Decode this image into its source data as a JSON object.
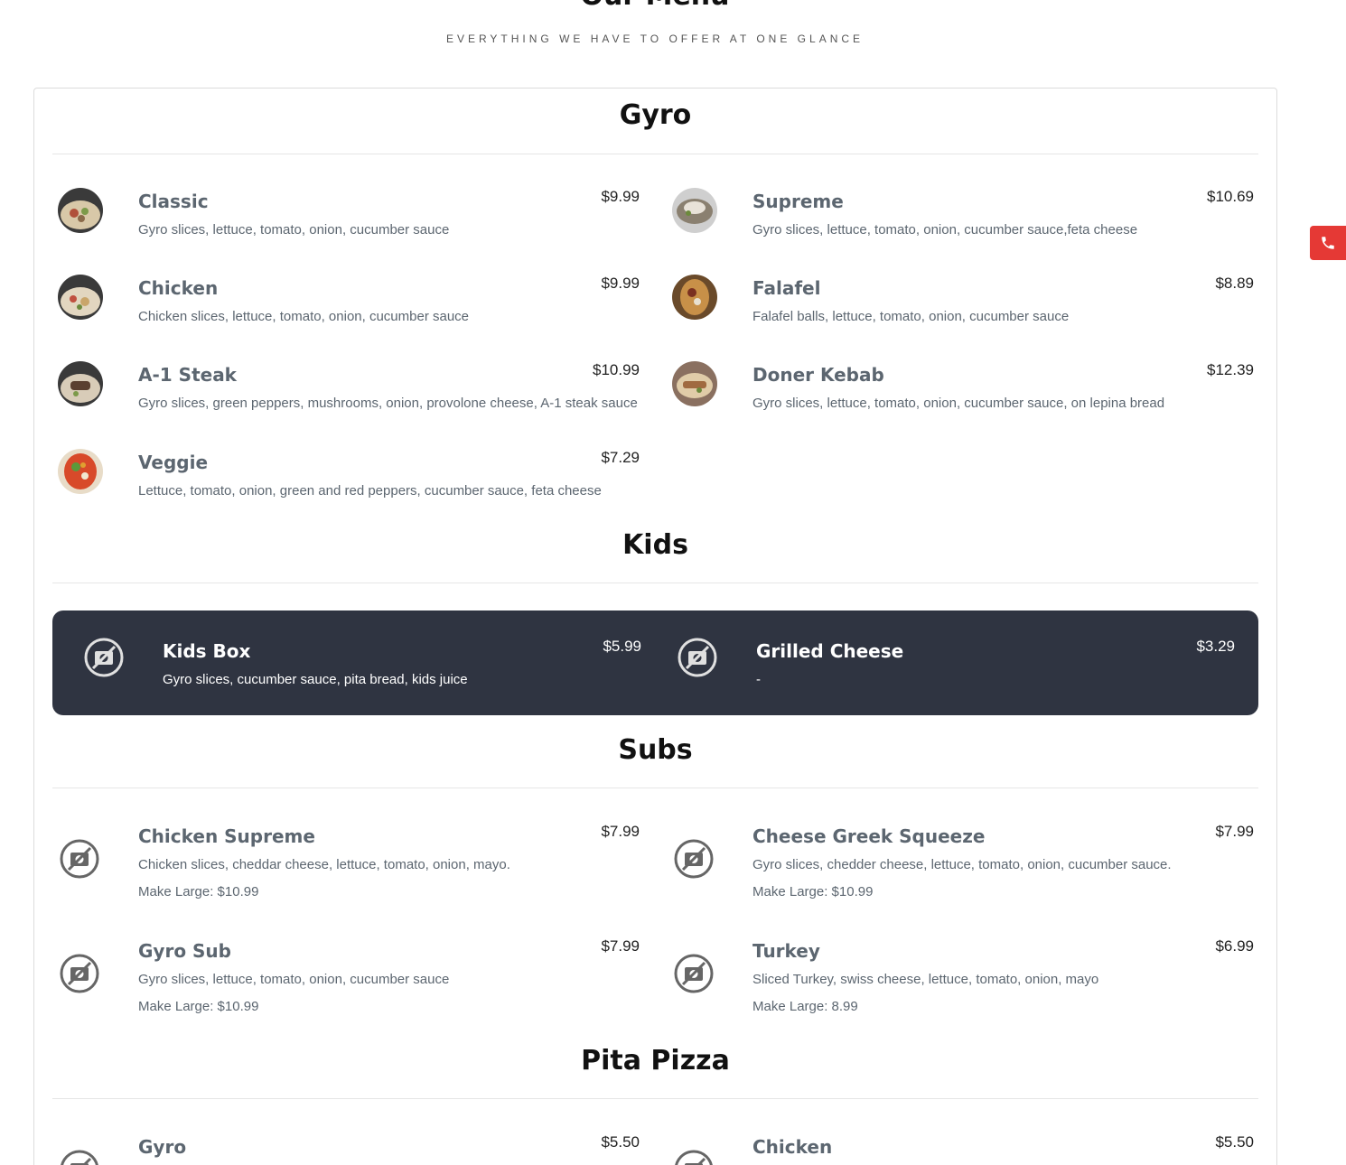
{
  "header": {
    "title": "Our Menu",
    "subtitle": "EVERYTHING WE HAVE TO OFFER AT ONE GLANCE"
  },
  "sections": {
    "gyro": {
      "title": "Gyro",
      "items": [
        {
          "name": "Classic",
          "price": "$9.99",
          "desc": "Gyro slices, lettuce, tomato, onion, cucumber sauce"
        },
        {
          "name": "Supreme",
          "price": "$10.69",
          "desc": "Gyro slices, lettuce, tomato, onion, cucumber sauce,feta cheese"
        },
        {
          "name": "Chicken",
          "price": "$9.99",
          "desc": "Chicken slices, lettuce, tomato, onion, cucumber sauce"
        },
        {
          "name": "Falafel",
          "price": "$8.89",
          "desc": "Falafel balls, lettuce, tomato, onion, cucumber sauce"
        },
        {
          "name": "A-1 Steak",
          "price": "$10.99",
          "desc": "Gyro slices, green peppers, mushrooms, onion, provolone cheese, A-1 steak sauce"
        },
        {
          "name": "Doner Kebab",
          "price": "$12.39",
          "desc": "Gyro slices, lettuce, tomato, onion, cucumber sauce, on lepina bread"
        },
        {
          "name": "Veggie",
          "price": "$7.29",
          "desc": "Lettuce, tomato, onion, green and red peppers, cucumber sauce, feta cheese"
        }
      ]
    },
    "kids": {
      "title": "Kids",
      "items": [
        {
          "name": "Kids Box",
          "price": "$5.99",
          "desc": "Gyro slices, cucumber sauce, pita bread, kids juice"
        },
        {
          "name": "Grilled Cheese",
          "price": "$3.29",
          "desc": "-"
        }
      ]
    },
    "subs": {
      "title": "Subs",
      "items": [
        {
          "name": "Chicken Supreme",
          "price": "$7.99",
          "desc": "Chicken slices, cheddar cheese, lettuce, tomato, onion, mayo.",
          "extra": "Make Large: $10.99"
        },
        {
          "name": "Cheese Greek Squeeze",
          "price": "$7.99",
          "desc": "Gyro slices, chedder cheese, lettuce, tomato, onion, cucumber sauce.",
          "extra": "Make Large: $10.99"
        },
        {
          "name": "Gyro Sub",
          "price": "$7.99",
          "desc": "Gyro slices, lettuce, tomato, onion, cucumber sauce",
          "extra": "Make Large: $10.99"
        },
        {
          "name": "Turkey",
          "price": "$6.99",
          "desc": "Sliced Turkey, swiss cheese, lettuce, tomato, onion, mayo",
          "extra": "Make Large: 8.99"
        }
      ]
    },
    "pita_pizza": {
      "title": "Pita Pizza",
      "items": [
        {
          "name": "Gyro",
          "price": "$5.50"
        },
        {
          "name": "Chicken",
          "price": "$5.50"
        }
      ]
    }
  },
  "icons": {
    "no_image": "no-image-icon",
    "phone": "phone-icon"
  },
  "colors": {
    "accent_red": "#e53935",
    "kids_band": "#2f3441",
    "item_text": "#5c6670"
  }
}
